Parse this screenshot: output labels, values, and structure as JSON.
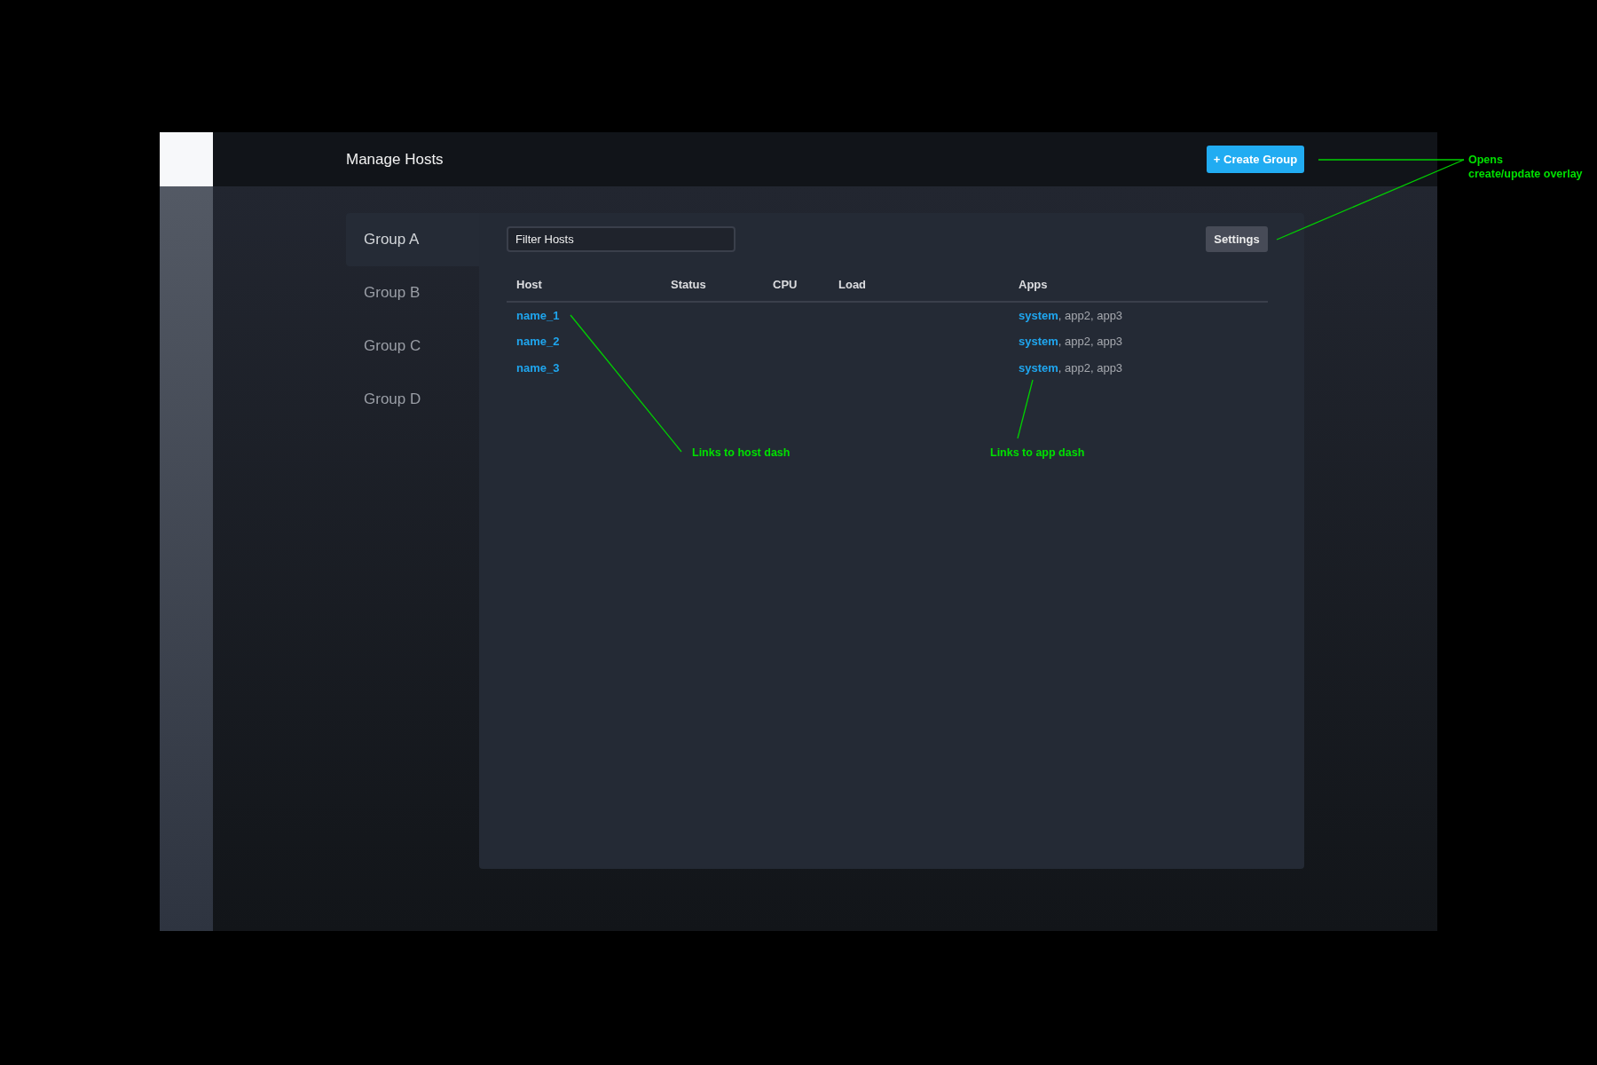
{
  "header": {
    "title": "Manage Hosts",
    "create_button": "+ Create Group"
  },
  "groups": [
    {
      "label": "Group A",
      "selected": true
    },
    {
      "label": "Group B",
      "selected": false
    },
    {
      "label": "Group C",
      "selected": false
    },
    {
      "label": "Group D",
      "selected": false
    }
  ],
  "filter": {
    "placeholder": "Filter Hosts"
  },
  "settings_button": "Settings",
  "table": {
    "columns": [
      "Host",
      "Status",
      "CPU",
      "Load",
      "Apps"
    ],
    "rows": [
      {
        "host": "name_1",
        "app_link": "system",
        "app_rest": ", app2, app3"
      },
      {
        "host": "name_2",
        "app_link": "system",
        "app_rest": ", app2, app3"
      },
      {
        "host": "name_3",
        "app_link": "system",
        "app_rest": ", app2, app3"
      }
    ]
  },
  "annotations": [
    "Opens\ncreate/update overlay",
    "Links to host dash",
    "Links to app dash"
  ]
}
